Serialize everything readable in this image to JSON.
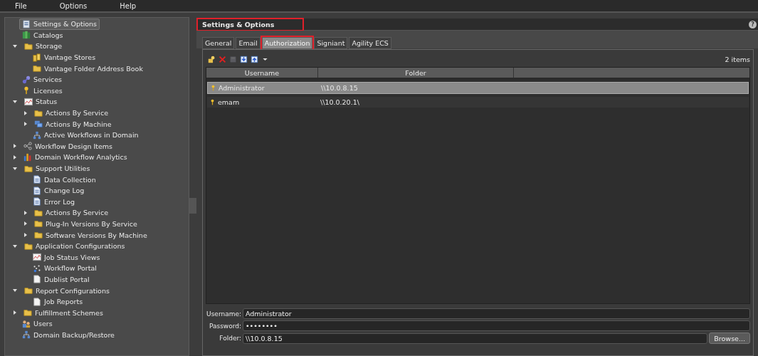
{
  "menu": [
    "File",
    "Options",
    "Help"
  ],
  "sidebar": {
    "items": [
      {
        "label": "Settings & Options",
        "kind": "settings",
        "selected": true
      },
      {
        "label": "Catalogs",
        "kind": "catalog",
        "selected": false
      },
      {
        "label": "Storage",
        "kind": "folder",
        "selected": false,
        "expanded": true,
        "children": [
          {
            "label": "Vantage Stores",
            "kind": "store",
            "selected": false
          },
          {
            "label": "Vantage Folder Address Book",
            "kind": "folder",
            "selected": false
          }
        ]
      },
      {
        "label": "Services",
        "kind": "services",
        "selected": false
      },
      {
        "label": "Licenses",
        "kind": "key",
        "selected": false
      },
      {
        "label": "Status",
        "kind": "chart",
        "selected": false,
        "expanded": true,
        "children": [
          {
            "label": "Actions By Service",
            "kind": "folder",
            "selected": false,
            "expanded": false
          },
          {
            "label": "Actions By Machine",
            "kind": "machine",
            "selected": false,
            "expanded": false
          },
          {
            "label": "Active Workflows in Domain",
            "kind": "network",
            "selected": false
          }
        ]
      },
      {
        "label": "Workflow Design Items",
        "kind": "workflow",
        "selected": false,
        "expanded": false
      },
      {
        "label": "Domain Workflow Analytics",
        "kind": "bars",
        "selected": false,
        "expanded": false
      },
      {
        "label": "Support Utilities",
        "kind": "folder",
        "selected": false,
        "expanded": true,
        "children": [
          {
            "label": "Data Collection",
            "kind": "document",
            "selected": false
          },
          {
            "label": "Change Log",
            "kind": "document",
            "selected": false
          },
          {
            "label": "Error Log",
            "kind": "document",
            "selected": false
          },
          {
            "label": "Actions By Service",
            "kind": "folder",
            "selected": false,
            "expanded": false
          },
          {
            "label": "Plug-In Versions By Service",
            "kind": "folder",
            "selected": false,
            "expanded": false
          },
          {
            "label": "Software Versions By Machine",
            "kind": "folder",
            "selected": false,
            "expanded": false
          }
        ]
      },
      {
        "label": "Application Configurations",
        "kind": "folder",
        "selected": false,
        "expanded": true,
        "children": [
          {
            "label": "Job Status Views",
            "kind": "chart",
            "selected": false
          },
          {
            "label": "Workflow Portal",
            "kind": "dots",
            "selected": false
          },
          {
            "label": "Dublist Portal",
            "kind": "page",
            "selected": false
          }
        ]
      },
      {
        "label": "Report Configurations",
        "kind": "folder",
        "selected": false,
        "expanded": true,
        "children": [
          {
            "label": "Job Reports",
            "kind": "page",
            "selected": false
          }
        ]
      },
      {
        "label": "Fulfillment Schemes",
        "kind": "folder",
        "selected": false,
        "expanded": false
      },
      {
        "label": "Users",
        "kind": "users",
        "selected": false
      },
      {
        "label": "Domain Backup/Restore",
        "kind": "network",
        "selected": false
      }
    ]
  },
  "panel": {
    "title": "Settings & Options",
    "highlighted": true,
    "help": "?",
    "tabs": [
      {
        "label": "General",
        "selected": false,
        "highlighted": false
      },
      {
        "label": "Email",
        "selected": false,
        "highlighted": false
      },
      {
        "label": "Authorization",
        "selected": true,
        "highlighted": true
      },
      {
        "label": "Signiant",
        "selected": false,
        "highlighted": false
      },
      {
        "label": "Agility ECS",
        "selected": false,
        "highlighted": false
      }
    ],
    "toolbar": [
      {
        "kind": "add",
        "disabled": false
      },
      {
        "kind": "delete",
        "disabled": false
      },
      {
        "kind": "save",
        "disabled": true
      },
      {
        "kind": "import",
        "disabled": false
      },
      {
        "kind": "export",
        "disabled": false
      },
      {
        "kind": "dropdown",
        "disabled": false
      }
    ],
    "count": "2 items",
    "table": {
      "columns": [
        "Username",
        "Folder"
      ],
      "rows": [
        {
          "username": "Administrator",
          "folder": "\\\\10.0.8.15",
          "selected": true
        },
        {
          "username": "emam",
          "folder": "\\\\10.0.20.1\\",
          "selected": false
        }
      ]
    },
    "form": {
      "username_label": "Username:",
      "username": "Administrator",
      "password_label": "Password:",
      "password": "••••••••",
      "folder_label": "Folder:",
      "folder": "\\\\10.0.8.15",
      "browse": "Browse..."
    }
  }
}
